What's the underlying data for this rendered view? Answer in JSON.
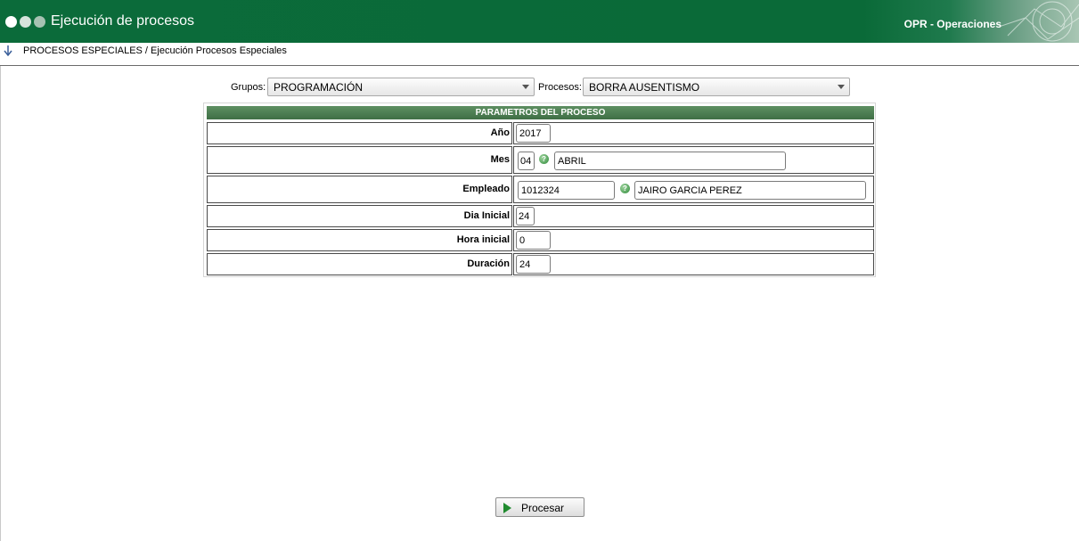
{
  "header": {
    "title": "Ejecución de procesos",
    "module": "OPR - Operaciones",
    "accent": "#0b6b3a"
  },
  "breadcrumb": {
    "icon": "down-arrow-icon",
    "text": "PROCESOS ESPECIALES / Ejecución Procesos Especiales"
  },
  "filters": {
    "groups_label": "Grupos:",
    "groups_value": "PROGRAMACIÓN",
    "process_label": "Procesos:",
    "process_value": "BORRA AUSENTISMO"
  },
  "params": {
    "title": "PARAMETROS DEL PROCESO",
    "rows": [
      {
        "label": "Año",
        "value": "2017"
      },
      {
        "label": "Mes",
        "value": "04",
        "desc": "ABRIL"
      },
      {
        "label": "Empleado",
        "value": "1012324",
        "desc": "JAIRO GARCIA PEREZ"
      },
      {
        "label": "Dia Inicial",
        "value": "24"
      },
      {
        "label": "Hora inicial",
        "value": "0"
      },
      {
        "label": "Duración",
        "value": "24"
      }
    ]
  },
  "actions": {
    "process_label": "Procesar",
    "process_icon": "play-icon"
  }
}
